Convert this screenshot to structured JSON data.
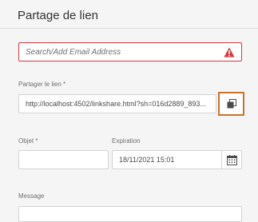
{
  "dialog": {
    "title": "Partage de lien"
  },
  "email": {
    "placeholder": "Search/Add Email Address",
    "status_icon": "alert-triangle-icon",
    "error_color": "#d7373f"
  },
  "share_link": {
    "label": "Partager le lien *",
    "value": "http://localhost:4502/linkshare.html?sh=016d2889_893...",
    "copy_icon": "copy-icon",
    "copy_highlight_color": "#c8732a"
  },
  "subject": {
    "label": "Objet *",
    "value": ""
  },
  "expiration": {
    "label": "Expiration",
    "value": "18/11/2021 15:01",
    "calendar_icon": "calendar-icon"
  },
  "message": {
    "label": "Message"
  }
}
